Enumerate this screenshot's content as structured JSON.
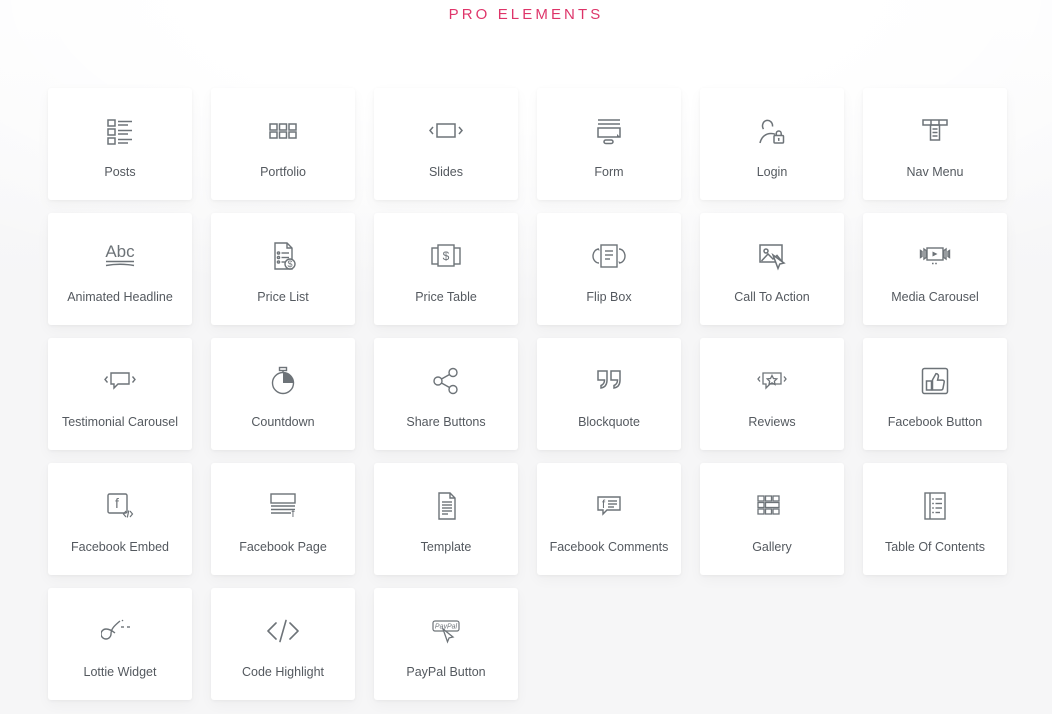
{
  "header": {
    "title": "PRO ELEMENTS",
    "title_color": "#d6316b"
  },
  "theme": {
    "card_background": "#ffffff",
    "page_background": "#f7f7f8",
    "label_color": "#54595f",
    "icon_color": "#6d7378"
  },
  "grid": {
    "columns": 6,
    "items": [
      {
        "label": "Posts",
        "icon": "posts-list-icon"
      },
      {
        "label": "Portfolio",
        "icon": "portfolio-grid-icon"
      },
      {
        "label": "Slides",
        "icon": "slides-carousel-icon"
      },
      {
        "label": "Form",
        "icon": "form-screen-icon"
      },
      {
        "label": "Login",
        "icon": "login-user-lock-icon"
      },
      {
        "label": "Nav Menu",
        "icon": "nav-menu-icon"
      },
      {
        "label": "Animated Headline",
        "icon": "animated-headline-abc-icon"
      },
      {
        "label": "Price List",
        "icon": "price-list-document-icon"
      },
      {
        "label": "Price Table",
        "icon": "price-table-cards-icon"
      },
      {
        "label": "Flip Box",
        "icon": "flip-box-icon"
      },
      {
        "label": "Call To Action",
        "icon": "call-to-action-image-cursor-icon"
      },
      {
        "label": "Media Carousel",
        "icon": "media-carousel-play-icon"
      },
      {
        "label": "Testimonial Carousel",
        "icon": "testimonial-speech-bubble-icon"
      },
      {
        "label": "Countdown",
        "icon": "countdown-stopwatch-icon"
      },
      {
        "label": "Share Buttons",
        "icon": "share-network-icon"
      },
      {
        "label": "Blockquote",
        "icon": "blockquote-quotes-icon"
      },
      {
        "label": "Reviews",
        "icon": "reviews-star-bubble-icon"
      },
      {
        "label": "Facebook Button",
        "icon": "facebook-thumbs-up-icon"
      },
      {
        "label": "Facebook Embed",
        "icon": "facebook-embed-code-icon"
      },
      {
        "label": "Facebook Page",
        "icon": "facebook-page-icon"
      },
      {
        "label": "Template",
        "icon": "template-document-icon"
      },
      {
        "label": "Facebook Comments",
        "icon": "facebook-comments-bubble-icon"
      },
      {
        "label": "Gallery",
        "icon": "gallery-mosaic-icon"
      },
      {
        "label": "Table Of Contents",
        "icon": "table-of-contents-icon"
      },
      {
        "label": "Lottie Widget",
        "icon": "lottie-loop-icon"
      },
      {
        "label": "Code Highlight",
        "icon": "code-highlight-icon"
      },
      {
        "label": "PayPal Button",
        "icon": "paypal-button-icon"
      }
    ]
  }
}
